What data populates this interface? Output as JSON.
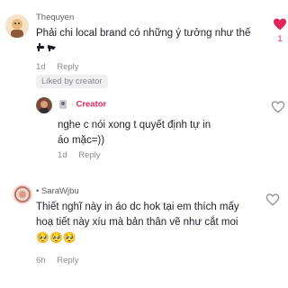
{
  "comments": [
    {
      "username": "Thequyen",
      "text": "Phải chi local brand có những ý tưởng như thế",
      "time": "1d",
      "reply_label": "Reply",
      "liked_by_creator": "Liked by creator",
      "liked": true,
      "like_count": "1",
      "accent": "#e0245e",
      "reply": {
        "creator_label": "Creator",
        "text": "nghe c nói xong t quyết định tự in áo mặc=))",
        "time": "1d",
        "reply_label": "Reply"
      }
    },
    {
      "username": "SaraWjbu",
      "text": "Thiết nghĩ này in áo dc hok tại em thích mấy hoạ tiết này xíu mà bản thân vẽ như cắt moi",
      "emojis": "🥺🥺🥺",
      "time": "6h",
      "reply_label": "Reply"
    }
  ]
}
